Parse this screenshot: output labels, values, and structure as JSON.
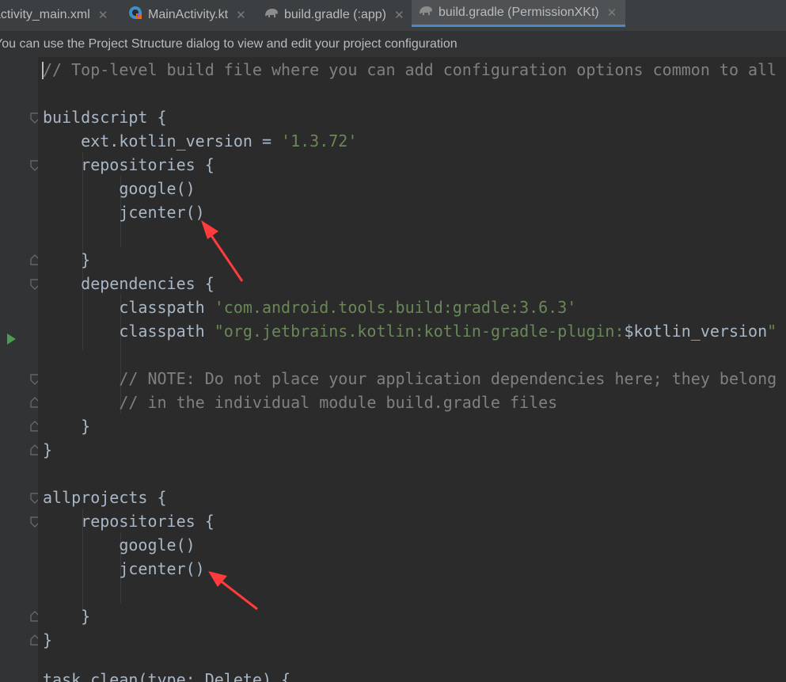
{
  "tabs": [
    {
      "label": "activity_main.xml",
      "close": "✕",
      "icon": "",
      "active": false
    },
    {
      "label": "MainActivity.kt",
      "close": "✕",
      "icon": "kotlin-file-icon",
      "active": false
    },
    {
      "label": "build.gradle (:app)",
      "close": "✕",
      "icon": "gradle-elephant-icon",
      "active": false
    },
    {
      "label": "build.gradle (PermissionXKt)",
      "close": "✕",
      "icon": "gradle-elephant-icon",
      "active": true
    }
  ],
  "notification": {
    "text": "You can use the Project Structure dialog to view and edit your project configuration"
  },
  "code": {
    "l1": "// Top-level build file where you can add configuration options common to all sub-projects/modules.",
    "l3": "buildscript {",
    "l4a": "    ext.kotlin_version = ",
    "l4b": "'1.3.72'",
    "l5": "    repositories {",
    "l6": "        google()",
    "l7": "        jcenter()",
    "l9": "    }",
    "l10": "    dependencies {",
    "l11a": "        classpath ",
    "l11b": "'com.android.tools.build:gradle:3.6.3'",
    "l12a": "        classpath ",
    "l12b": "\"org.jetbrains.kotlin:kotlin-gradle-plugin:",
    "l12c": "$kotlin_version",
    "l12d": "\"",
    "l14": "        // NOTE: Do not place your application dependencies here; they belong",
    "l15": "        // in the individual module build.gradle files",
    "l16": "    }",
    "l17": "}",
    "l19": "allprojects {",
    "l20": "    repositories {",
    "l21": "        google()",
    "l22": "        jcenter()",
    "l24": "    }",
    "l25": "}",
    "l27": "task clean(type: Delete) {"
  },
  "colors": {
    "arrow": "#ff3b3b",
    "background": "#2b2b2b",
    "string": "#6a8759",
    "comment": "#808080",
    "text": "#a9b7c6"
  }
}
